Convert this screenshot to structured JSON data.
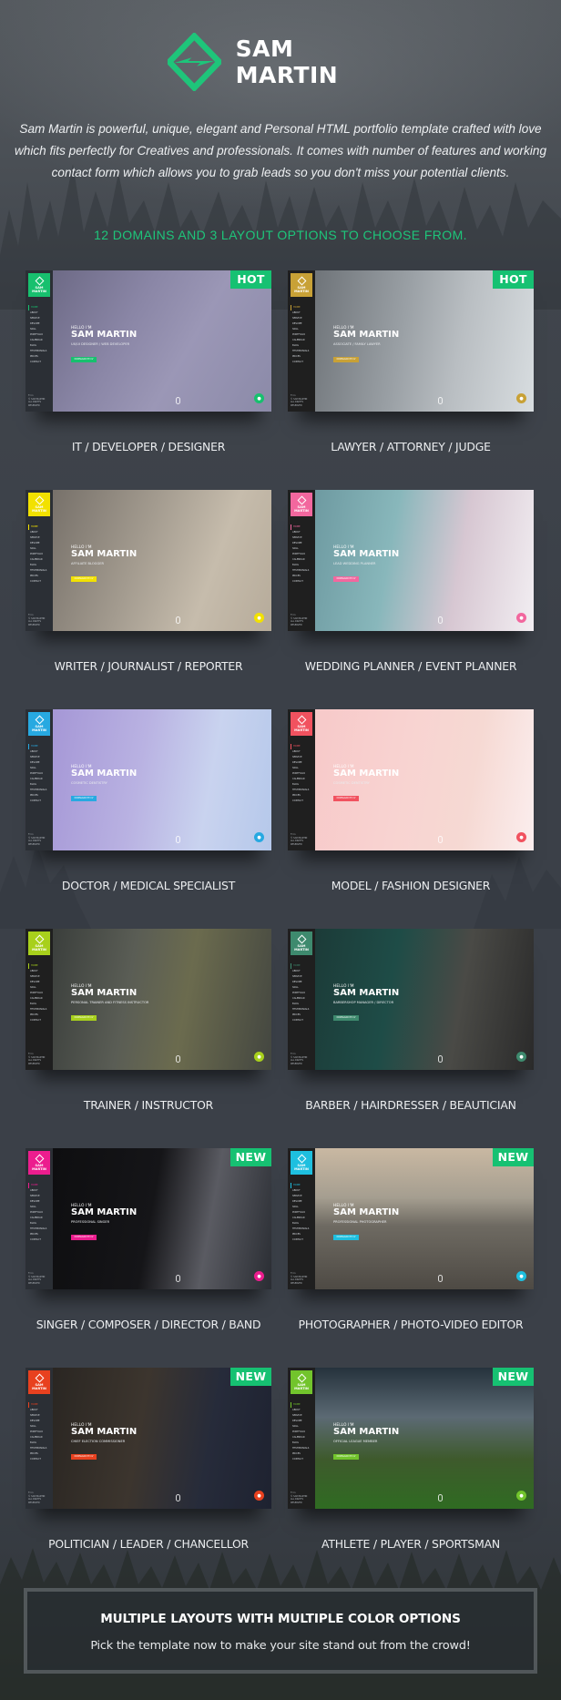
{
  "brand": {
    "name": "SAM MARTIN",
    "accent": "#1ec57a"
  },
  "intro": "Sam Martin is powerful, unique, elegant and Personal HTML portfolio template crafted with love which fits perfectly for Creatives and professionals. It comes with number of features and working contact form which allows you to grab leads so you don't miss your potential clients.",
  "tagline": "12 DOMAINS AND 3 LAYOUT OPTIONS TO CHOOSE FROM.",
  "preview_common": {
    "logo_line1": "SAM",
    "logo_line2": "MARTIN",
    "nav": [
      "HOME",
      "ABOUT",
      "SERVICE",
      "RESUME",
      "SKILL",
      "PORTFOLIO",
      "CALENDAR",
      "BLOG",
      "TESTIMONIALS",
      "PRICES",
      "CONTACT"
    ],
    "footer_icons": "f  t  in",
    "footer_line1": "© SAM MARTIN",
    "footer_line2": "ALL RIGHTS RESERVED",
    "hello": "HELLO I'M",
    "name": "SAM MARTIN",
    "button": "DOWNLOAD MY CV"
  },
  "demos": [
    {
      "label": "IT / DEVELOPER / DESIGNER",
      "role": "UX/UI DESIGNER / WEB DEVELOPER",
      "badge": "HOT",
      "color": "#17c06e",
      "bg": "linear-gradient(120deg,#6d6a86 0%,#8a86a6 35%,#9b97b6 60%,#8b8aa8 100%)",
      "side": "#2b2f35"
    },
    {
      "label": "LAWYER / ATTORNEY / JUDGE",
      "role": "ASSOCIATE / FAMILY LAWYER",
      "badge": "HOT",
      "color": "#c8a136",
      "bg": "linear-gradient(100deg,#6f7479 0%,#9aa0a5 40%,#b9bec2 65%,#d8dde0 100%)",
      "side": "#1f1f1f"
    },
    {
      "label": "WRITER / JOURNALIST / REPORTER",
      "role": "AFFILIATE BLOGGER",
      "badge": "",
      "color": "#f2e100",
      "bg": "linear-gradient(110deg,#77716a 0%,#a39b8f 40%,#c6bcac 70%,#b6ab9a 100%)",
      "side": "#2b2f35"
    },
    {
      "label": "WEDDING PLANNER / EVENT PLANNER",
      "role": "LEAD WEDDING PLANNER",
      "badge": "",
      "color": "#f2679e",
      "bg": "linear-gradient(100deg,#6e9aa1 0%,#88b7bb 35%,#d7c7d2 65%,#f2eef2 100%)",
      "side": "#1f1f1f"
    },
    {
      "label": "DOCTOR / MEDICAL SPECIALIST",
      "role": "COSMETIC DENTISTRY",
      "badge": "",
      "color": "#27a9e1",
      "bg": "linear-gradient(100deg,#a597d6 0%,#b9b2e2 40%,#c9d3ef 70%,#b5c8ea 100%)",
      "side": "#2b2f35"
    },
    {
      "label": "MODEL / FASHION DESIGNER",
      "role": "COSMETIC DENTISTRY",
      "badge": "",
      "color": "#f1525f",
      "bg": "linear-gradient(100deg,#f7c9c9 0%,#f8d3d1 40%,#f6d9d3 70%,#fbeeee 100%)",
      "side": "#1f1f1f"
    },
    {
      "label": "TRAINER /  INSTRUCTOR",
      "role": "PERSONAL TRAINER AND FITNESS INSTRUCTOR",
      "badge": "",
      "color": "#a8d01c",
      "bg": "linear-gradient(100deg,#3b3f3c 0%,#5a5d55 35%,#6b6b4e 60%,#434640 100%)",
      "side": "#1f1f1f"
    },
    {
      "label": "BARBER / HAIRDRESSER / BEAUTICIAN",
      "role": "BARBERSHOP MANAGER / DIRECTOR",
      "badge": "",
      "color": "#3e8a6e",
      "bg": "linear-gradient(100deg,#1c3b38 0%,#1e4c47 35%,#4a4a46 65%,#2a2a2a 100%)",
      "side": "#1f1f1f"
    },
    {
      "label": "SINGER / COMPOSER / DIRECTOR / BAND",
      "role": "PROFESSIONAL SINGER",
      "badge": "NEW",
      "color": "#ec1d8e",
      "bg": "linear-gradient(100deg,#0e0e10 0%,#151518 45%,#5a5b62 70%,#2a2d33 100%)",
      "side": "#2b2f35"
    },
    {
      "label": "PHOTOGRAPHER / PHOTO-VIDEO EDITOR",
      "role": "PROFESSIONAL PHOTOGRAPHER",
      "badge": "NEW",
      "color": "#1ebfdf",
      "bg": "linear-gradient(180deg,#c9b8a2 0%,#a59e90 35%,#6e6a62 55%,#4e4a44 100%)",
      "side": "#1f1f1f"
    },
    {
      "label": "POLITICIAN / LEADER / CHANCELLOR",
      "role": "CHIEF ELECTION COMMISSIONER",
      "badge": "NEW",
      "color": "#e8411f",
      "bg": "linear-gradient(100deg,#2a2622 0%,#3c352e 40%,#262b3a 70%,#1e2230 100%)",
      "side": "#2b2f35"
    },
    {
      "label": "ATHLETE / PLAYER / SPORTSMAN",
      "role": "OFFICIAL LEAGUE MEMBER",
      "badge": "NEW",
      "color": "#72c42c",
      "bg": "linear-gradient(180deg,#25323c 0%,#5c6a74 35%,#3e5a2c 65%,#2f6b22 100%)",
      "side": "#1f1f1f"
    }
  ],
  "cta": {
    "title": "MULTIPLE LAYOUTS WITH MULTIPLE COLOR OPTIONS",
    "subtitle": "Pick the template now to make your site stand out from the crowd!"
  }
}
